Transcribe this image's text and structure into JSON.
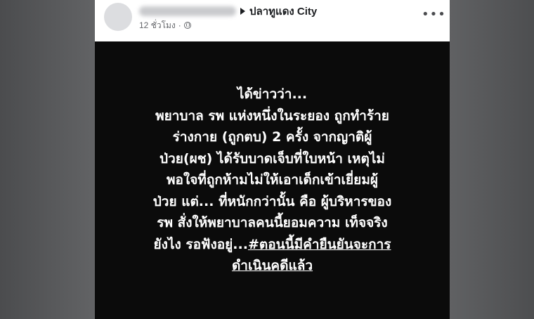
{
  "post": {
    "group_name": "ปลาทูแดง City",
    "time": "12 ชั่วโมง",
    "meta_dot": "·",
    "more_glyph": "•••",
    "lines": [
      "ได้ข่าวว่า...",
      "พยาบาล รพ แห่งหนึ่งในระยอง ถูกทำร้าย",
      "ร่างกาย (ถูกตบ) 2 ครั้ง จากญาติผู้",
      "ป่วย(ผช) ได้รับบาดเจ็บที่ใบหน้า เหตุไม่",
      "พอใจที่ถูกห้ามไม่ให้เอาเด็กเข้าเยี่ยมผู้",
      "ป่วย แต่... ที่หนักกว่านั้น คือ ผู้บริหารของ",
      "รพ สั่งให้พยาบาลคนนี้ยอมความ เท็จจริง"
    ],
    "line_before_tag": "ยังไง รอฟังอยู่...",
    "hashtag_part1": "#ตอนนี้มีคำยืนยันจะการ",
    "hashtag_part2": "ดำเนินคดีแล้ว"
  },
  "colors": {
    "background": "#58595b",
    "post_background": "#0b0b0b",
    "header_background": "#ffffff",
    "text": "#ffffff",
    "meta_text": "#65676b"
  },
  "icons": [
    "avatar",
    "play-arrow-icon",
    "globe-icon",
    "more-options-icon"
  ]
}
